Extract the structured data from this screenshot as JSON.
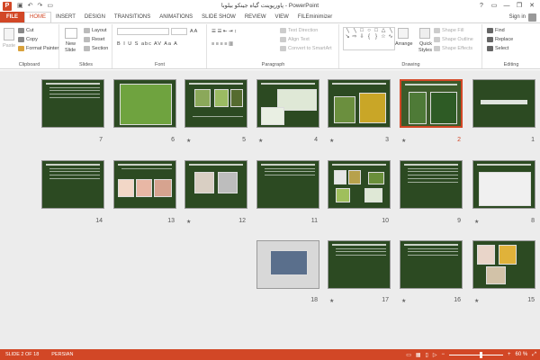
{
  "window": {
    "title": "پاورپوینت گیاه جینکو بیلوبا - PowerPoint",
    "app_icon": "P",
    "controls": [
      "?",
      "▭",
      "—",
      "❐",
      "✕"
    ]
  },
  "qat": [
    "save-icon",
    "undo-icon",
    "redo-icon",
    "slideshow-icon"
  ],
  "tabs": [
    "FILE",
    "HOME",
    "INSERT",
    "DESIGN",
    "TRANSITIONS",
    "ANIMATIONS",
    "SLIDE SHOW",
    "REVIEW",
    "VIEW",
    "FILEminimizer"
  ],
  "active_tab": "HOME",
  "signin": "Sign in",
  "ribbon": {
    "clipboard": {
      "label": "Clipboard",
      "paste": "Paste",
      "cut": "Cut",
      "copy": "Copy",
      "format_painter": "Format Painter"
    },
    "slides": {
      "label": "Slides",
      "new_slide_1": "New",
      "new_slide_2": "Slide",
      "layout": "Layout",
      "reset": "Reset",
      "section": "Section"
    },
    "font": {
      "label": "Font",
      "buttons": "B I U S abc AV Aa A"
    },
    "paragraph": {
      "label": "Paragraph",
      "text_direction": "Text Direction",
      "align_text": "Align Text",
      "convert_smartart": "Convert to SmartArt"
    },
    "drawing": {
      "label": "Drawing",
      "arrange": "Arrange",
      "quick_styles_1": "Quick",
      "quick_styles_2": "Styles",
      "shape_fill": "Shape Fill",
      "shape_outline": "Shape Outline",
      "shape_effects": "Shape Effects"
    },
    "editing": {
      "label": "Editing",
      "find": "Find",
      "replace": "Replace",
      "select": "Select"
    }
  },
  "slides": [
    {
      "num": "1",
      "star": false,
      "selected": false
    },
    {
      "num": "2",
      "star": true,
      "selected": true
    },
    {
      "num": "3",
      "star": true,
      "selected": false
    },
    {
      "num": "4",
      "star": true,
      "selected": false
    },
    {
      "num": "5",
      "star": true,
      "selected": false
    },
    {
      "num": "6",
      "star": false,
      "selected": false
    },
    {
      "num": "7",
      "star": false,
      "selected": false
    },
    {
      "num": "8",
      "star": true,
      "selected": false
    },
    {
      "num": "9",
      "star": false,
      "selected": false
    },
    {
      "num": "10",
      "star": false,
      "selected": false
    },
    {
      "num": "11",
      "star": false,
      "selected": false
    },
    {
      "num": "12",
      "star": true,
      "selected": false
    },
    {
      "num": "13",
      "star": false,
      "selected": false
    },
    {
      "num": "14",
      "star": false,
      "selected": false
    },
    {
      "num": "15",
      "star": true,
      "selected": false
    },
    {
      "num": "16",
      "star": true,
      "selected": false
    },
    {
      "num": "17",
      "star": true,
      "selected": false
    },
    {
      "num": "18",
      "star": false,
      "selected": false
    }
  ],
  "status": {
    "slide_of": "SLIDE 2 OF 18",
    "language": "PERSIAN",
    "zoom": "60 %",
    "zoom_fraction": 0.6
  },
  "colors": {
    "accent": "#d24726",
    "slide_bg": "#2c4a22"
  }
}
